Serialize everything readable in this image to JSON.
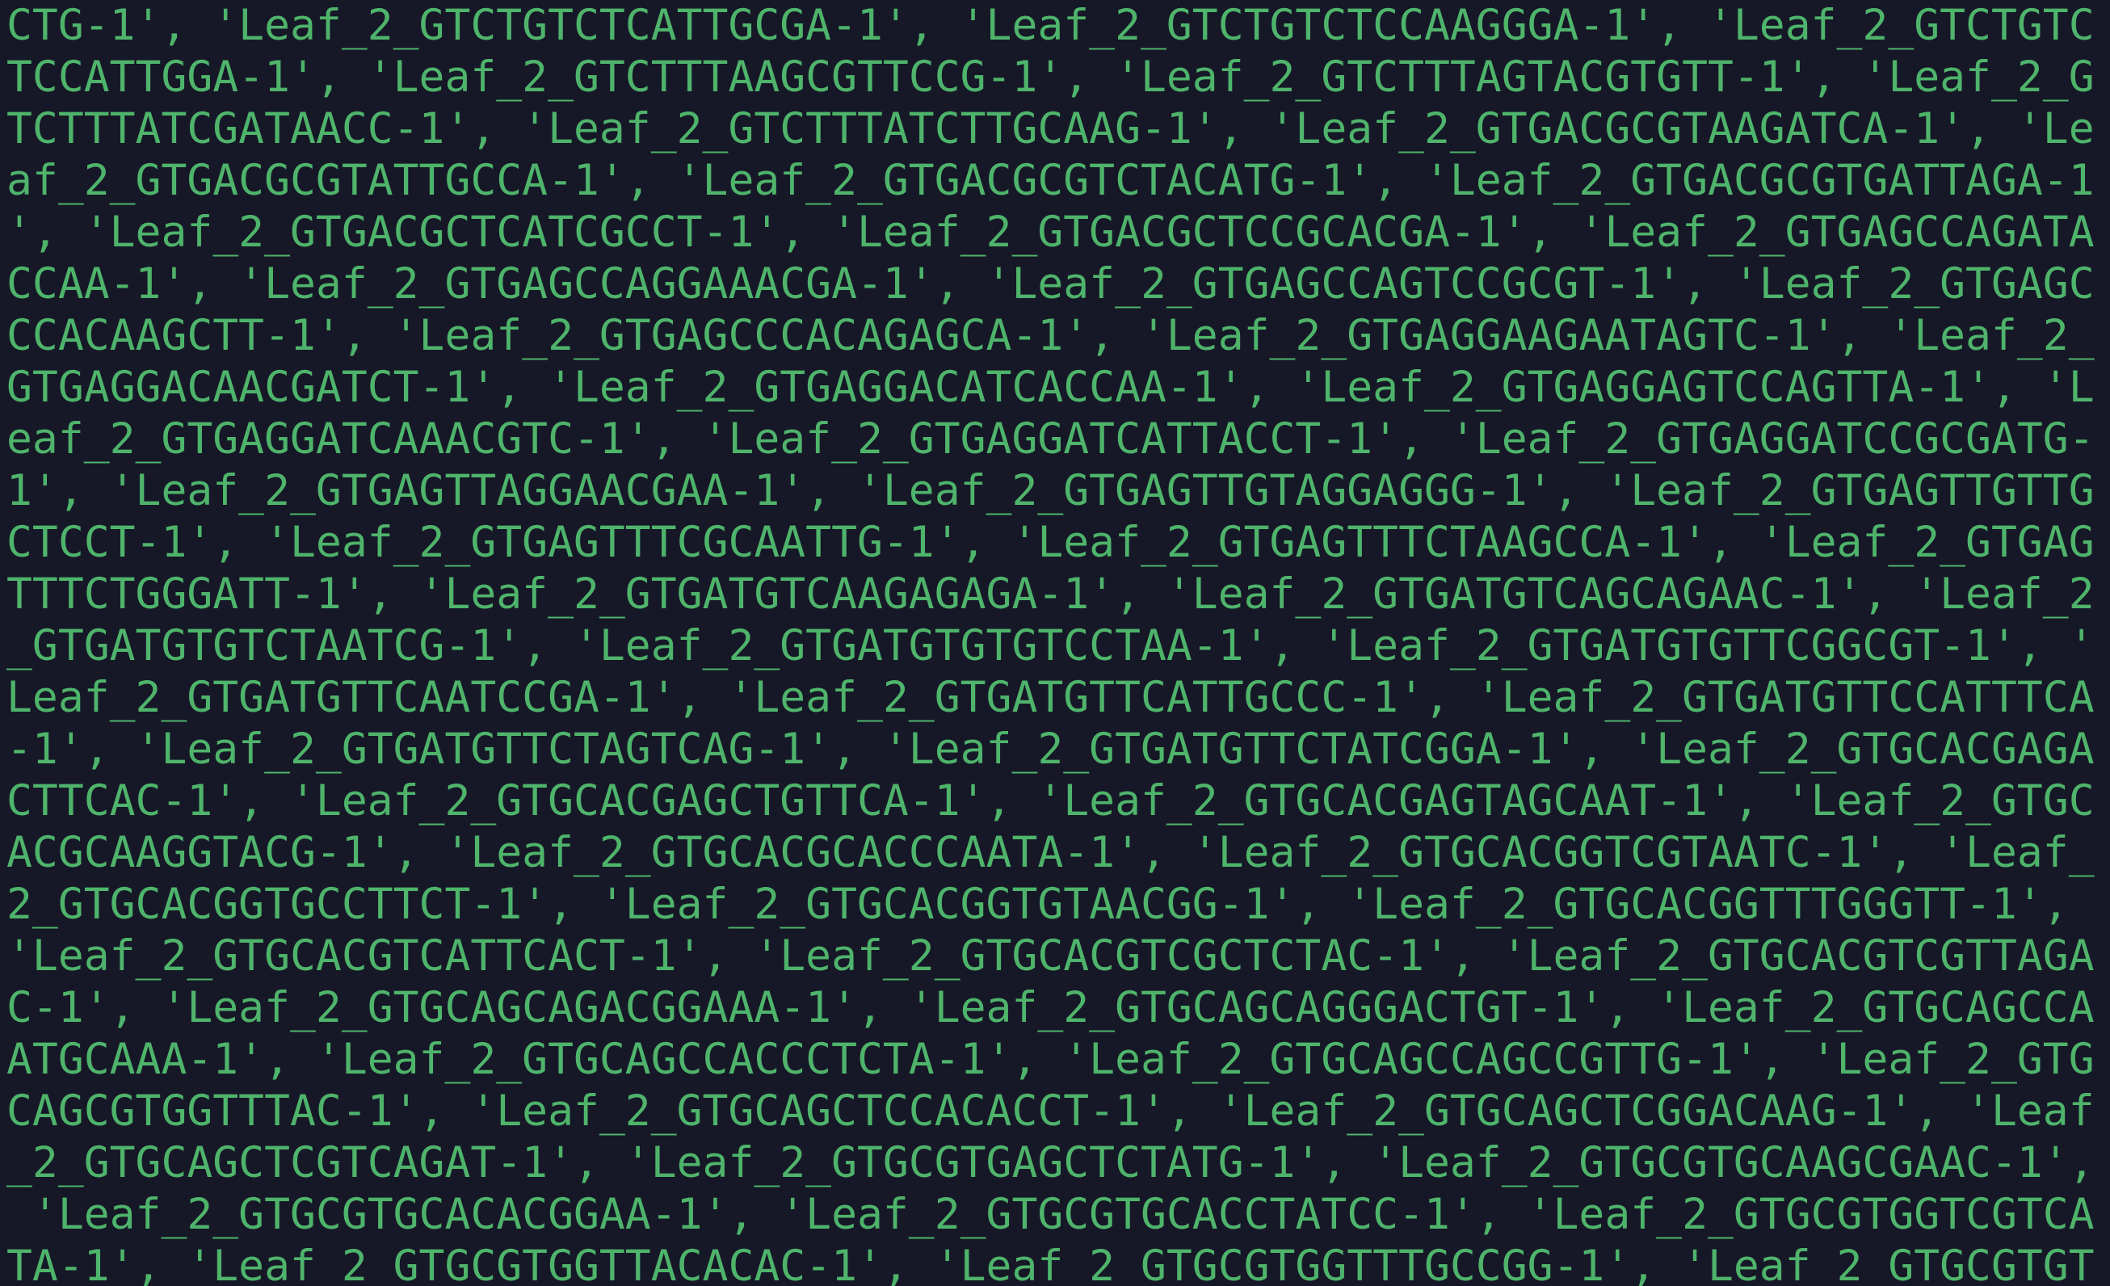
{
  "terminal": {
    "colors": {
      "background": "#161827",
      "text": "#4fb46b"
    },
    "lines": [
      "CTG-1', 'Leaf_2_GTCTGTCTCATTGCGA-1', 'Leaf_2_GTCTGTCTCCAAGGGA-1', 'Leaf_2_GTCTGTC",
      "TCCATTGGA-1', 'Leaf_2_GTCTTTAAGCGTTCCG-1', 'Leaf_2_GTCTTTAGTACGTGTT-1', 'Leaf_2_G",
      "TCTTTATCGATAACC-1', 'Leaf_2_GTCTTTATCTTGCAAG-1', 'Leaf_2_GTGACGCGTAAGATCA-1', 'Le",
      "af_2_GTGACGCGTATTGCCA-1', 'Leaf_2_GTGACGCGTCTACATG-1', 'Leaf_2_GTGACGCGTGATTAGA-1",
      "', 'Leaf_2_GTGACGCTCATCGCCT-1', 'Leaf_2_GTGACGCTCCGCACGA-1', 'Leaf_2_GTGAGCCAGATA",
      "CCAA-1', 'Leaf_2_GTGAGCCAGGAAACGA-1', 'Leaf_2_GTGAGCCAGTCCGCGT-1', 'Leaf_2_GTGAGC",
      "CCACAAGCTT-1', 'Leaf_2_GTGAGCCCACAGAGCA-1', 'Leaf_2_GTGAGGAAGAATAGTC-1', 'Leaf_2_",
      "GTGAGGACAACGATCT-1', 'Leaf_2_GTGAGGACATCACCAA-1', 'Leaf_2_GTGAGGAGTCCAGTTA-1', 'L",
      "eaf_2_GTGAGGATCAAACGTC-1', 'Leaf_2_GTGAGGATCATTACCT-1', 'Leaf_2_GTGAGGATCCGCGATG-",
      "1', 'Leaf_2_GTGAGTTAGGAACGAA-1', 'Leaf_2_GTGAGTTGTAGGAGGG-1', 'Leaf_2_GTGAGTTGTTG",
      "CTCCT-1', 'Leaf_2_GTGAGTTTCGCAATTG-1', 'Leaf_2_GTGAGTTTCTAAGCCA-1', 'Leaf_2_GTGAG",
      "TTTCTGGGATT-1', 'Leaf_2_GTGATGTCAAGAGAGA-1', 'Leaf_2_GTGATGTCAGCAGAAC-1', 'Leaf_2",
      "_GTGATGTGTCTAATCG-1', 'Leaf_2_GTGATGTGTGTCCTAA-1', 'Leaf_2_GTGATGTGTTCGGCGT-1', '",
      "Leaf_2_GTGATGTTCAATCCGA-1', 'Leaf_2_GTGATGTTCATTGCCC-1', 'Leaf_2_GTGATGTTCCATTTCA",
      "-1', 'Leaf_2_GTGATGTTCTAGTCAG-1', 'Leaf_2_GTGATGTTCTATCGGA-1', 'Leaf_2_GTGCACGAGA",
      "CTTCAC-1', 'Leaf_2_GTGCACGAGCTGTTCA-1', 'Leaf_2_GTGCACGAGTAGCAAT-1', 'Leaf_2_GTGC",
      "ACGCAAGGTACG-1', 'Leaf_2_GTGCACGCACCCAATA-1', 'Leaf_2_GTGCACGGTCGTAATC-1', 'Leaf_",
      "2_GTGCACGGTGCCTTCT-1', 'Leaf_2_GTGCACGGTGTAACGG-1', 'Leaf_2_GTGCACGGTTTGGGTT-1', ",
      "'Leaf_2_GTGCACGTCATTCACT-1', 'Leaf_2_GTGCACGTCGCTCTAC-1', 'Leaf_2_GTGCACGTCGTTAGA",
      "C-1', 'Leaf_2_GTGCAGCAGACGGAAA-1', 'Leaf_2_GTGCAGCAGGGACTGT-1', 'Leaf_2_GTGCAGCCA",
      "ATGCAAA-1', 'Leaf_2_GTGCAGCCACCCTCTA-1', 'Leaf_2_GTGCAGCCAGCCGTTG-1', 'Leaf_2_GTG",
      "CAGCGTGGTTTAC-1', 'Leaf_2_GTGCAGCTCCACACCT-1', 'Leaf_2_GTGCAGCTCGGACAAG-1', 'Leaf",
      "_2_GTGCAGCTCGTCAGAT-1', 'Leaf_2_GTGCGTGAGCTCTATG-1', 'Leaf_2_GTGCGTGCAAGCGAAC-1',",
      " 'Leaf_2_GTGCGTGCACACGGAA-1', 'Leaf_2_GTGCGTGCACCTATCC-1', 'Leaf_2_GTGCGTGGTCGTCA",
      "TA-1', 'Leaf_2_GTGCGTGGTTACACAC-1', 'Leaf_2_GTGCGTGGTTTGCCGG-1', 'Leaf_2_GTGCGTGT"
    ]
  }
}
